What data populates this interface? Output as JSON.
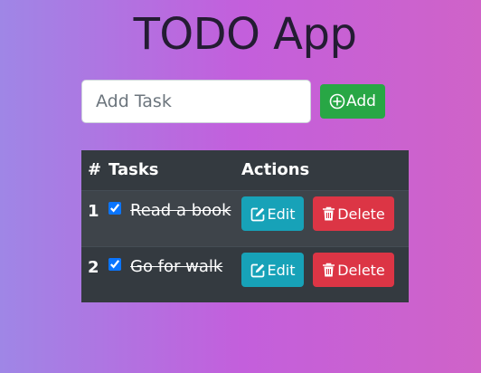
{
  "title": "TODO App",
  "new_task": {
    "placeholder": "Add Task",
    "value": "",
    "add_label": "Add",
    "add_icon": "plus-circle-icon"
  },
  "table": {
    "headers": [
      "#",
      "Tasks",
      "Actions"
    ],
    "rows": [
      {
        "number": "1",
        "done": true,
        "task": "Read a book",
        "edit_label": "Edit",
        "delete_label": "Delete"
      },
      {
        "number": "2",
        "done": true,
        "task": "Go for walk",
        "edit_label": "Edit",
        "delete_label": "Delete"
      }
    ]
  },
  "icons": {
    "edit": "edit-icon",
    "delete": "trash-icon"
  },
  "colors": {
    "add_button": "#28a745",
    "edit_button": "#17a2b8",
    "delete_button": "#dc3545",
    "table_background": "#343a40"
  }
}
